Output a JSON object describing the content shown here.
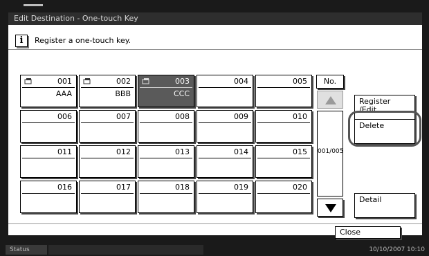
{
  "window": {
    "title": "Edit Destination - One-touch Key"
  },
  "message": {
    "text": "Register a one-touch key."
  },
  "keys": [
    {
      "num": "001",
      "name": "AAA"
    },
    {
      "num": "002",
      "name": "BBB"
    },
    {
      "num": "003",
      "name": "CCC"
    },
    {
      "num": "004",
      "name": ""
    },
    {
      "num": "005",
      "name": ""
    },
    {
      "num": "006",
      "name": ""
    },
    {
      "num": "007",
      "name": ""
    },
    {
      "num": "008",
      "name": ""
    },
    {
      "num": "009",
      "name": ""
    },
    {
      "num": "010",
      "name": ""
    },
    {
      "num": "011",
      "name": ""
    },
    {
      "num": "012",
      "name": ""
    },
    {
      "num": "013",
      "name": ""
    },
    {
      "num": "014",
      "name": ""
    },
    {
      "num": "015",
      "name": ""
    },
    {
      "num": "016",
      "name": ""
    },
    {
      "num": "017",
      "name": ""
    },
    {
      "num": "018",
      "name": ""
    },
    {
      "num": "019",
      "name": ""
    },
    {
      "num": "020",
      "name": ""
    }
  ],
  "selected_key": "003",
  "nav": {
    "no_label": "No.",
    "page": "001/005"
  },
  "side": {
    "register_label": "Register\n/Edit",
    "delete_label": "Delete",
    "detail_label": "Detail"
  },
  "footer": {
    "close_label": "Close"
  },
  "status": {
    "label": "Status",
    "datetime": "10/10/2007   10:10"
  }
}
